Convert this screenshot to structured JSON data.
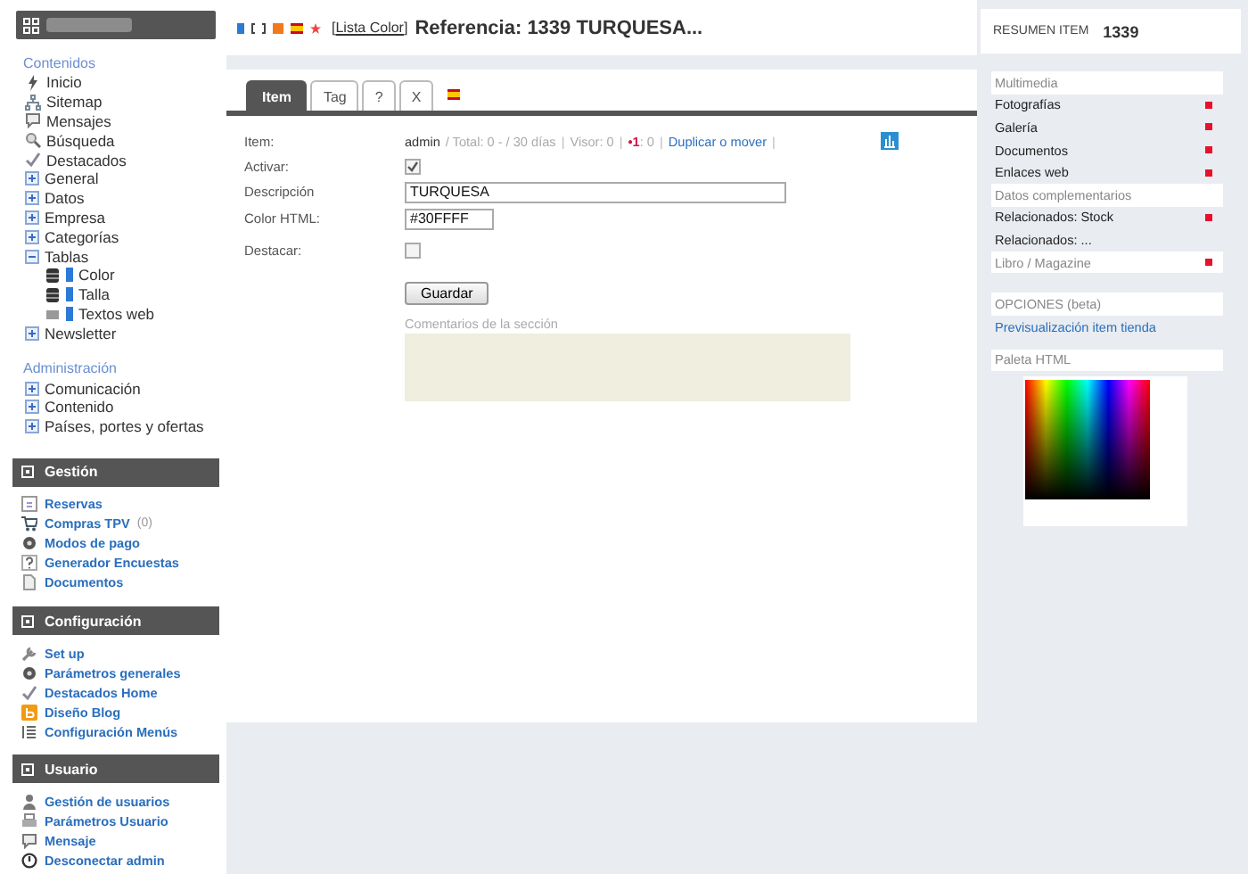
{
  "sidebar": {
    "sections": [
      {
        "title": "Contenidos",
        "items": [
          {
            "kind": "link",
            "label": "Inicio"
          },
          {
            "kind": "link",
            "label": "Sitemap"
          },
          {
            "kind": "link",
            "label": "Mensajes"
          },
          {
            "kind": "link",
            "label": "Búsqueda"
          },
          {
            "kind": "link",
            "label": "Destacados"
          },
          {
            "kind": "folder",
            "label": "General",
            "expanded": false
          },
          {
            "kind": "folder",
            "label": "Datos",
            "expanded": false
          },
          {
            "kind": "folder",
            "label": "Empresa",
            "expanded": false
          },
          {
            "kind": "folder",
            "label": "Categorías",
            "expanded": false
          },
          {
            "kind": "folder",
            "label": "Tablas",
            "expanded": true,
            "children": [
              {
                "label": "Color"
              },
              {
                "label": "Talla"
              },
              {
                "label": "Textos web"
              }
            ]
          },
          {
            "kind": "folder",
            "label": "Newsletter",
            "expanded": false
          }
        ]
      },
      {
        "title": "Administración",
        "items": [
          {
            "kind": "folder",
            "label": "Comunicación",
            "expanded": false
          },
          {
            "kind": "folder",
            "label": "Contenido",
            "expanded": false
          },
          {
            "kind": "folder",
            "label": "Países, portes y ofertas",
            "expanded": false
          }
        ]
      }
    ],
    "panels": [
      {
        "title": "Gestión",
        "items": [
          {
            "label": "Reservas"
          },
          {
            "label": "Compras TPV",
            "count": "(0)"
          },
          {
            "label": "Modos de pago"
          },
          {
            "label": "Generador Encuestas"
          },
          {
            "label": "Documentos"
          }
        ]
      },
      {
        "title": "Configuración",
        "items": [
          {
            "label": "Set up"
          },
          {
            "label": "Parámetros generales"
          },
          {
            "label": "Destacados Home"
          },
          {
            "label": "Diseño Blog"
          },
          {
            "label": "Configuración Menús"
          }
        ]
      },
      {
        "title": "Usuario",
        "items": [
          {
            "label": "Gestión de usuarios"
          },
          {
            "label": "Parámetros Usuario"
          },
          {
            "label": "Mensaje"
          },
          {
            "label": "Desconectar admin"
          }
        ]
      }
    ]
  },
  "header": {
    "bracket_open": "[",
    "list_link": "Lista Color",
    "bracket_close": "]",
    "title": "Referencia: 1339 TURQUESA..."
  },
  "tabs": [
    {
      "label": "Item",
      "selected": true
    },
    {
      "label": "Tag",
      "selected": false
    },
    {
      "label": "?",
      "selected": false
    },
    {
      "label": "X",
      "selected": false
    }
  ],
  "form": {
    "item_label": "Item:",
    "meta": [
      {
        "kind": "owner",
        "text": "admin"
      },
      {
        "kind": "muted",
        "text": "/ Total: 0 -  / 30 días"
      },
      {
        "kind": "separator",
        "text": "|"
      },
      {
        "kind": "muted",
        "text": "Visor: 0"
      },
      {
        "kind": "separator",
        "text": "|"
      },
      {
        "kind": "votes",
        "mark": "•1",
        "text": ": 0"
      },
      {
        "kind": "separator",
        "text": "|"
      },
      {
        "kind": "link",
        "text": "Duplicar o mover"
      },
      {
        "kind": "separator",
        "text": "|"
      }
    ],
    "fields": [
      {
        "kind": "checkbox",
        "label": "Activar:",
        "checked": true
      },
      {
        "kind": "text",
        "label": "Descripción",
        "value": "TURQUESA"
      },
      {
        "kind": "short",
        "label": "Color HTML:",
        "value": "#30FFFF"
      },
      {
        "kind": "checkbox",
        "label": "Destacar:",
        "checked": false
      }
    ],
    "save_button": "Guardar",
    "comments_label": "Comentarios de la sección"
  },
  "summary": {
    "title": "RESUMEN ITEM",
    "number": "1339",
    "rows": [
      {
        "kind": "header",
        "label": "Multimedia",
        "marked": false
      },
      {
        "kind": "item",
        "label": "Fotografías",
        "marked": true
      },
      {
        "kind": "item",
        "label": "Galería",
        "marked": true
      },
      {
        "kind": "item",
        "label": "Documentos",
        "marked": true
      },
      {
        "kind": "item",
        "label": "Enlaces web",
        "marked": true
      },
      {
        "kind": "header",
        "label": "Datos complementarios",
        "marked": false
      },
      {
        "kind": "item",
        "label": "Relacionados: Stock",
        "marked": true
      },
      {
        "kind": "item",
        "label": "Relacionados: ...",
        "marked": false
      },
      {
        "kind": "header",
        "label": "Libro / Magazine",
        "marked": true
      }
    ],
    "options_title": "OPCIONES (beta)",
    "preview_link": "Previsualización item tienda",
    "palette_title": "Paleta HTML"
  }
}
